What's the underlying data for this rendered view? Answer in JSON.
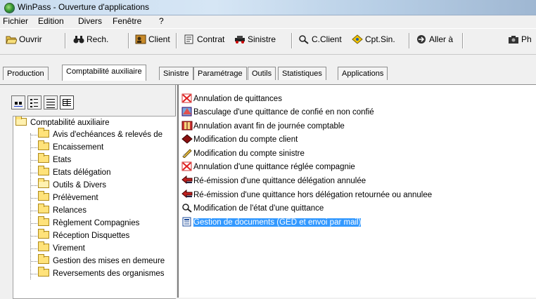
{
  "window": {
    "title": "WinPass - Ouverture d'applications"
  },
  "menu": [
    "Fichier",
    "Edition",
    "Divers",
    "Fenêtre",
    "?"
  ],
  "toolbar": {
    "open": "Ouvrir",
    "search": "Rech.",
    "client": "Client",
    "contract": "Contrat",
    "claim": "Sinistre",
    "c_client": "C.Client",
    "cpt_sin": "Cpt.Sin.",
    "goto": "Aller à",
    "photo": "Ph"
  },
  "tabs": [
    {
      "label": "Production",
      "active": false
    },
    {
      "label": "Comptabilité auxiliaire",
      "active": true
    },
    {
      "label": "Sinistre",
      "active": false
    },
    {
      "label": "Paramétrage",
      "active": false
    },
    {
      "label": "Outils",
      "active": false
    },
    {
      "label": "Statistiques",
      "active": false
    },
    {
      "label": "Applications",
      "active": false
    }
  ],
  "tree": {
    "root": "Comptabilité auxiliaire",
    "children": [
      "Avis d'echéances & relevés de",
      "Encaissement",
      "Etats",
      "Etats délégation",
      "Outils & Divers",
      "Prélèvement",
      "Relances",
      "Règlement Compagnies",
      "Réception Disquettes",
      "Virement",
      "Gestion des mises en demeure",
      "Reversements des organismes"
    ],
    "open_item": "Outils & Divers"
  },
  "list": {
    "items": [
      {
        "label": "Annulation de quittances",
        "icon": "cancel-receipt-icon"
      },
      {
        "label": "Basculage d'une quittance de confié en non confié",
        "icon": "swap-receipt-icon"
      },
      {
        "label": "Annulation avant fin de journée comptable",
        "icon": "ledger-icon"
      },
      {
        "label": "Modification du compte client",
        "icon": "client-account-icon"
      },
      {
        "label": "Modification du compte sinistre",
        "icon": "claim-account-icon"
      },
      {
        "label": "Annulation d'une quittance réglée compagnie",
        "icon": "cancel-receipt-icon"
      },
      {
        "label": "Ré-émission d'une quittance délégation annulée",
        "icon": "reissue-icon"
      },
      {
        "label": "Ré-émission d'une quittance hors délégation retournée ou annulee",
        "icon": "reissue-icon"
      },
      {
        "label": "Modification de l'état d'une quittance",
        "icon": "magnifier-icon"
      },
      {
        "label": "Gestion de documents (GED et envoi par mail)",
        "icon": "document-icon"
      }
    ],
    "selected_index": 9
  },
  "colors": {
    "selection": "#3399ff",
    "titlebar": "#c9dcef"
  }
}
